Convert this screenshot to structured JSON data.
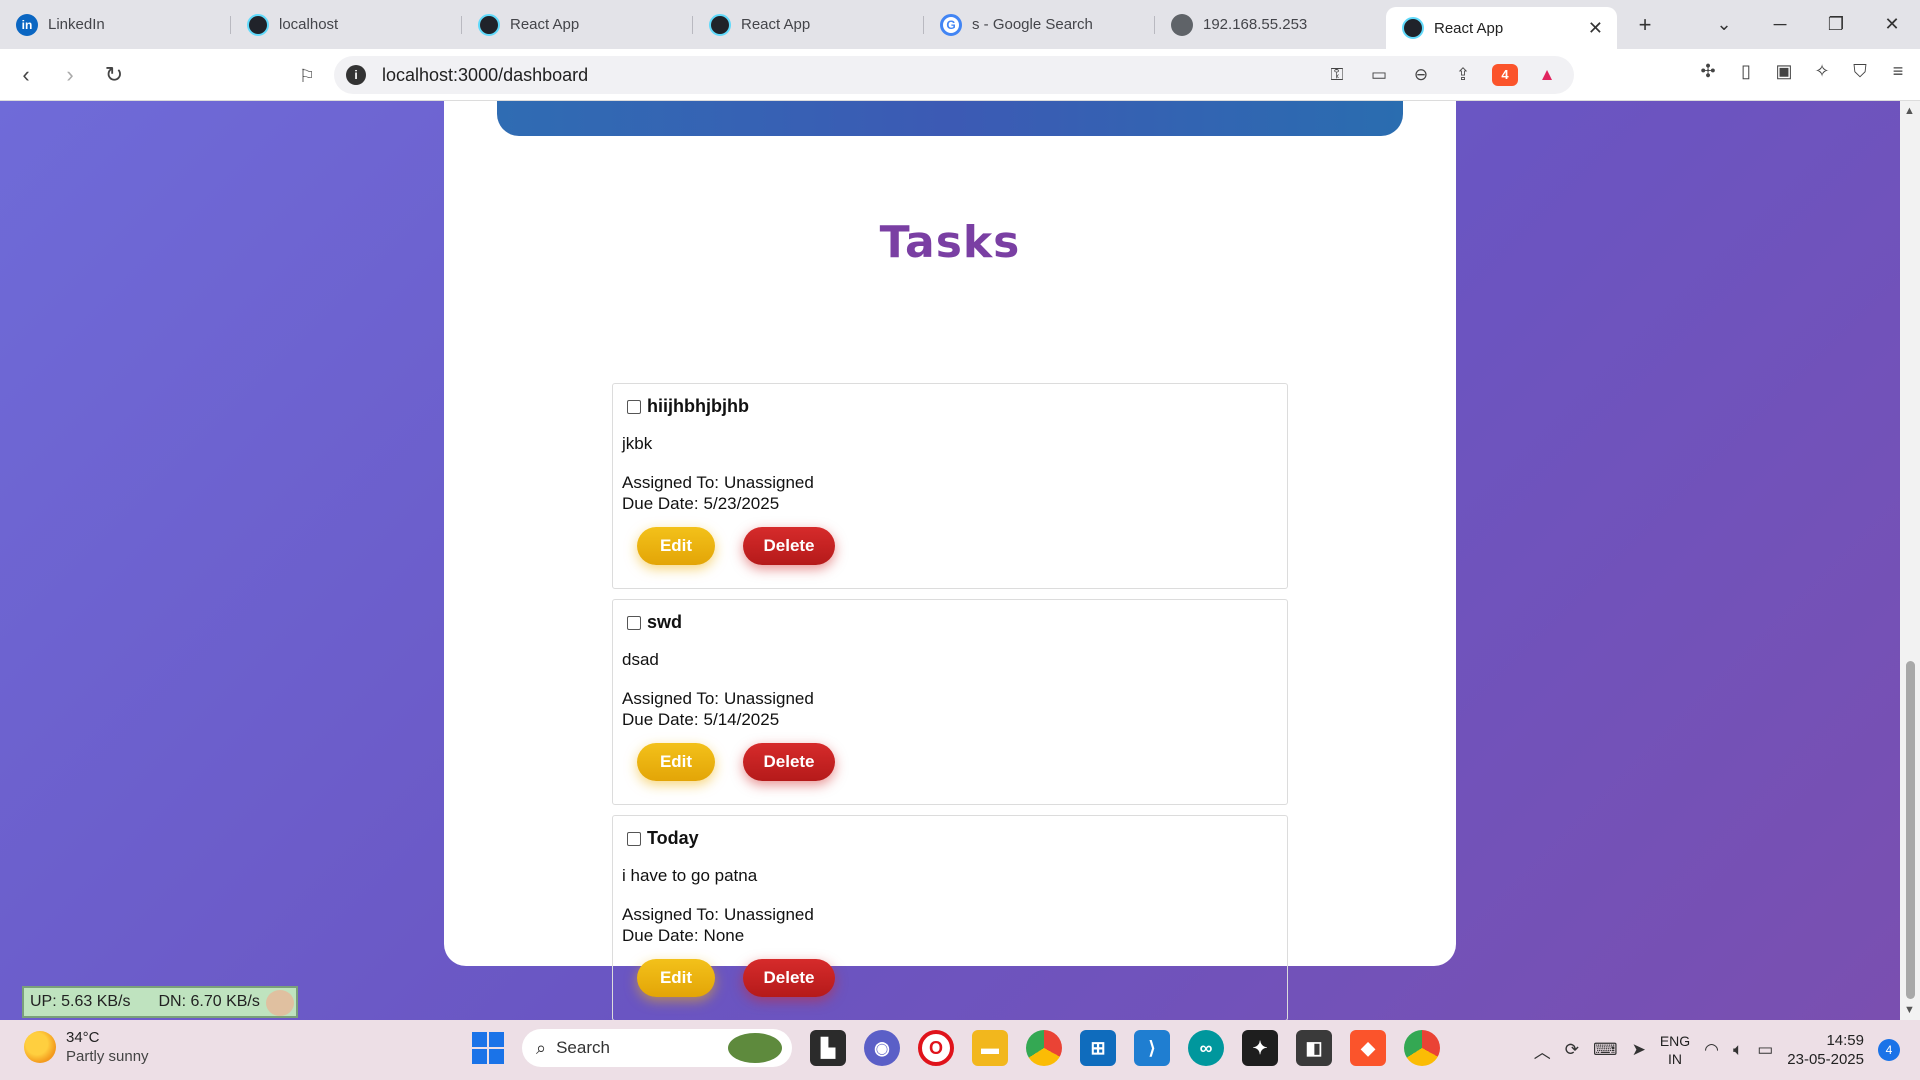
{
  "browser": {
    "tabs": [
      {
        "label": "LinkedIn",
        "icon": "linkedin-icon"
      },
      {
        "label": "localhost",
        "icon": "react-icon"
      },
      {
        "label": "React App",
        "icon": "react-icon"
      },
      {
        "label": "React App",
        "icon": "react-icon"
      },
      {
        "label": "s - Google Search",
        "icon": "google-icon"
      },
      {
        "label": "192.168.55.253",
        "icon": "globe-icon"
      },
      {
        "label": "React App",
        "icon": "react-icon",
        "active": true
      }
    ],
    "url": "localhost:3000/dashboard",
    "brave_badge": "4"
  },
  "page": {
    "heading": "Tasks",
    "tasks": [
      {
        "title": "hiijhbhjbjhb",
        "description": "jkbk",
        "assigned_label": "Assigned To:",
        "assigned": "Unassigned",
        "due_label": "Due Date:",
        "due": "5/23/2025",
        "edit_label": "Edit",
        "delete_label": "Delete"
      },
      {
        "title": "swd",
        "description": "dsad",
        "assigned_label": "Assigned To:",
        "assigned": "Unassigned",
        "due_label": "Due Date:",
        "due": "5/14/2025",
        "edit_label": "Edit",
        "delete_label": "Delete"
      },
      {
        "title": "Today",
        "description": "i have to go patna",
        "assigned_label": "Assigned To:",
        "assigned": "Unassigned",
        "due_label": "Due Date:",
        "due": "None",
        "edit_label": "Edit",
        "delete_label": "Delete"
      }
    ],
    "colors": {
      "heading": "#7a3fa3",
      "edit": "#f0b70f",
      "delete": "#c62222"
    }
  },
  "netspeed": {
    "up": "UP: 5.63 KB/s",
    "down": "DN: 6.70 KB/s"
  },
  "taskbar": {
    "weather_temp": "34°C",
    "weather_cond": "Partly sunny",
    "search_placeholder": "Search",
    "lang_1": "ENG",
    "lang_2": "IN",
    "time": "14:59",
    "date": "23-05-2025",
    "notifications": "4"
  }
}
